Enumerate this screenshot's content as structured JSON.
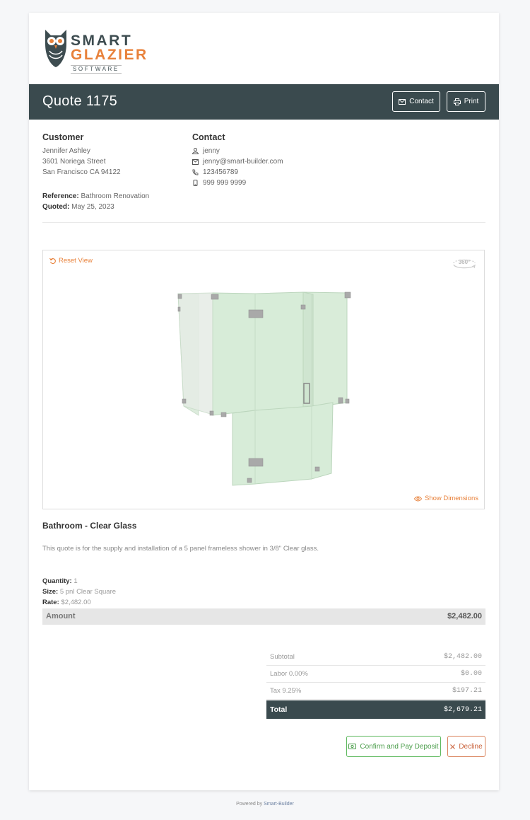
{
  "brand": {
    "line1": "SMART",
    "line2": "GLAZIER",
    "line3": "SOFTWARE",
    "colors": {
      "dark": "#3d4c50",
      "accent": "#e8813a"
    }
  },
  "header": {
    "title": "Quote 1175",
    "contact_label": "Contact",
    "print_label": "Print"
  },
  "customer": {
    "heading": "Customer",
    "name": "Jennifer Ashley",
    "street": "3601 Noriega Street",
    "city": "San Francisco CA 94122",
    "reference_label": "Reference:",
    "reference": "Bathroom Renovation",
    "quoted_label": "Quoted:",
    "quoted": "May 25, 2023"
  },
  "contact": {
    "heading": "Contact",
    "name": "jenny",
    "email": "jenny@smart-builder.com",
    "phone": "123456789",
    "mobile": "999 999 9999"
  },
  "viewer": {
    "reset_label": "Reset View",
    "show_dimensions_label": "Show Dimensions",
    "rotate_label": "360°"
  },
  "product": {
    "title": "Bathroom - Clear Glass",
    "description": "This quote is for the supply and installation of a 5 panel frameless shower in 3/8\" Clear glass.",
    "quantity_label": "Quantity:",
    "quantity": "1",
    "size_label": "Size:",
    "size": "5 pnl Clear Square",
    "rate_label": "Rate:",
    "rate": "$2,482.00",
    "amount_label": "Amount",
    "amount": "$2,482.00"
  },
  "totals": {
    "subtotal_label": "Subtotal",
    "subtotal": "$2,482.00",
    "labor_label": "Labor 0.00%",
    "labor": "$0.00",
    "tax_label": "Tax 9.25%",
    "tax": "$197.21",
    "total_label": "Total",
    "total": "$2,679.21"
  },
  "actions": {
    "confirm_label": "Confirm and Pay Deposit",
    "decline_label": "Decline"
  },
  "footer": {
    "prefix": "Powered by",
    "link": "Smart-Builder"
  }
}
